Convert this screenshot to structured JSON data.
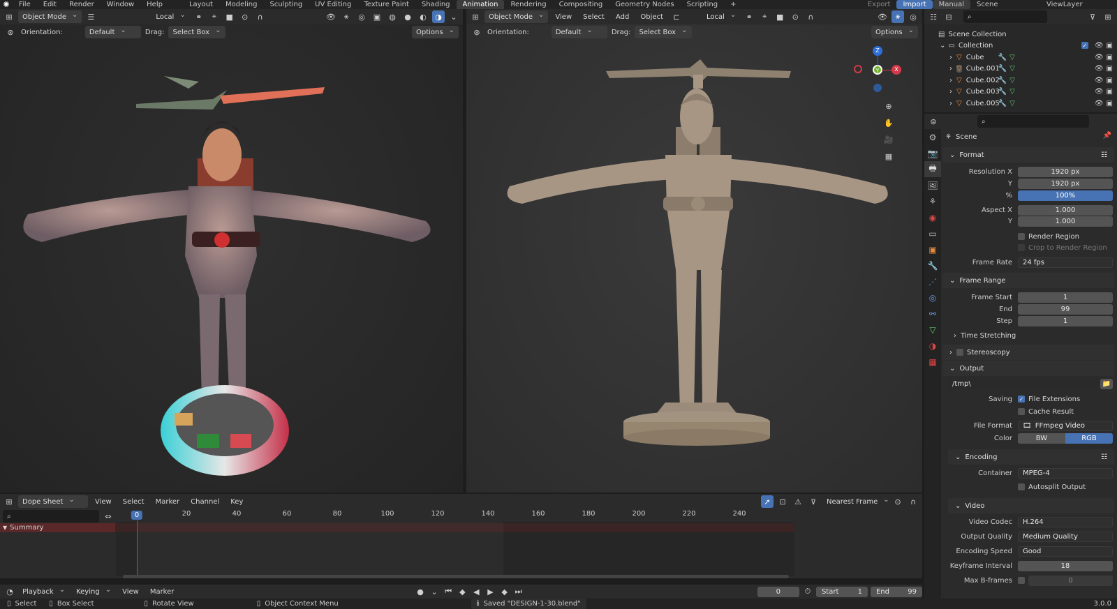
{
  "menu": [
    "File",
    "Edit",
    "Render",
    "Window",
    "Help"
  ],
  "workspaces": [
    "Layout",
    "Modeling",
    "Sculpting",
    "UV Editing",
    "Texture Paint",
    "Shading",
    "Animation",
    "Rendering",
    "Compositing",
    "Geometry Nodes",
    "Scripting"
  ],
  "active_workspace": "Animation",
  "top_right": {
    "export": "Export",
    "import": "Import",
    "manual": "Manual",
    "scene": "Scene",
    "view_layer": "ViewLayer"
  },
  "viewport_left": {
    "mode": "Object Mode",
    "transform": "Local",
    "orientation_label": "Orientation:",
    "orientation": "Default",
    "drag_label": "Drag:",
    "drag": "Select Box",
    "options": "Options"
  },
  "viewport_right": {
    "mode": "Object Mode",
    "menus": [
      "View",
      "Select",
      "Add",
      "Object"
    ],
    "transform": "Local",
    "orientation_label": "Orientation:",
    "orientation": "Default",
    "drag_label": "Drag:",
    "drag": "Select Box",
    "options": "Options"
  },
  "gizmo": {
    "z": "Z",
    "x": "X",
    "y": "Y"
  },
  "outliner": {
    "root": "Scene Collection",
    "collection": "Collection",
    "items": [
      "Cube",
      "Cube.001",
      "Cube.002",
      "Cube.003",
      "Cube.005"
    ]
  },
  "properties": {
    "context": "Scene",
    "format": {
      "title": "Format",
      "resolution_x_label": "Resolution X",
      "resolution_x": "1920 px",
      "resolution_y_label": "Y",
      "resolution_y": "1920 px",
      "percent_label": "%",
      "percent": "100%",
      "aspect_x_label": "Aspect X",
      "aspect_x": "1.000",
      "aspect_y_label": "Y",
      "aspect_y": "1.000",
      "render_region": "Render Region",
      "crop": "Crop to Render Region",
      "frame_rate_label": "Frame Rate",
      "frame_rate": "24 fps"
    },
    "frame_range": {
      "title": "Frame Range",
      "start_label": "Frame Start",
      "start": "1",
      "end_label": "End",
      "end": "99",
      "step_label": "Step",
      "step": "1",
      "time_stretching": "Time Stretching"
    },
    "stereoscopy": "Stereoscopy",
    "output": {
      "title": "Output",
      "path": "/tmp\\",
      "saving_label": "Saving",
      "file_extensions": "File Extensions",
      "cache_result": "Cache Result",
      "file_format_label": "File Format",
      "file_format": "FFmpeg Video",
      "color_label": "Color",
      "color_bw": "BW",
      "color_rgb": "RGB"
    },
    "encoding": {
      "title": "Encoding",
      "container_label": "Container",
      "container": "MPEG-4",
      "autosplit": "Autosplit Output"
    },
    "video": {
      "title": "Video",
      "codec_label": "Video Codec",
      "codec": "H.264",
      "quality_label": "Output Quality",
      "quality": "Medium Quality",
      "speed_label": "Encoding Speed",
      "speed": "Good",
      "keyframe_label": "Keyframe Interval",
      "keyframe": "18",
      "bframes_label": "Max B-frames",
      "bframes": "0"
    }
  },
  "dopesheet": {
    "editor": "Dope Sheet",
    "menus": [
      "View",
      "Select",
      "Marker",
      "Channel",
      "Key"
    ],
    "snap": "Nearest Frame",
    "summary": "Summary",
    "current_frame": "0",
    "ticks": [
      "20",
      "40",
      "60",
      "80",
      "100",
      "120",
      "140",
      "160",
      "180",
      "200",
      "220",
      "240"
    ]
  },
  "playbar": {
    "menus": [
      "Playback",
      "Keying",
      "View",
      "Marker"
    ],
    "frame": "0",
    "start_label": "Start",
    "start": "1",
    "end_label": "End",
    "end": "99"
  },
  "status": {
    "select": "Select",
    "box_select": "Box Select",
    "rotate": "Rotate View",
    "context_menu": "Object Context Menu",
    "message": "Saved \"DESIGN-1-30.blend\"",
    "version": "3.0.0"
  }
}
